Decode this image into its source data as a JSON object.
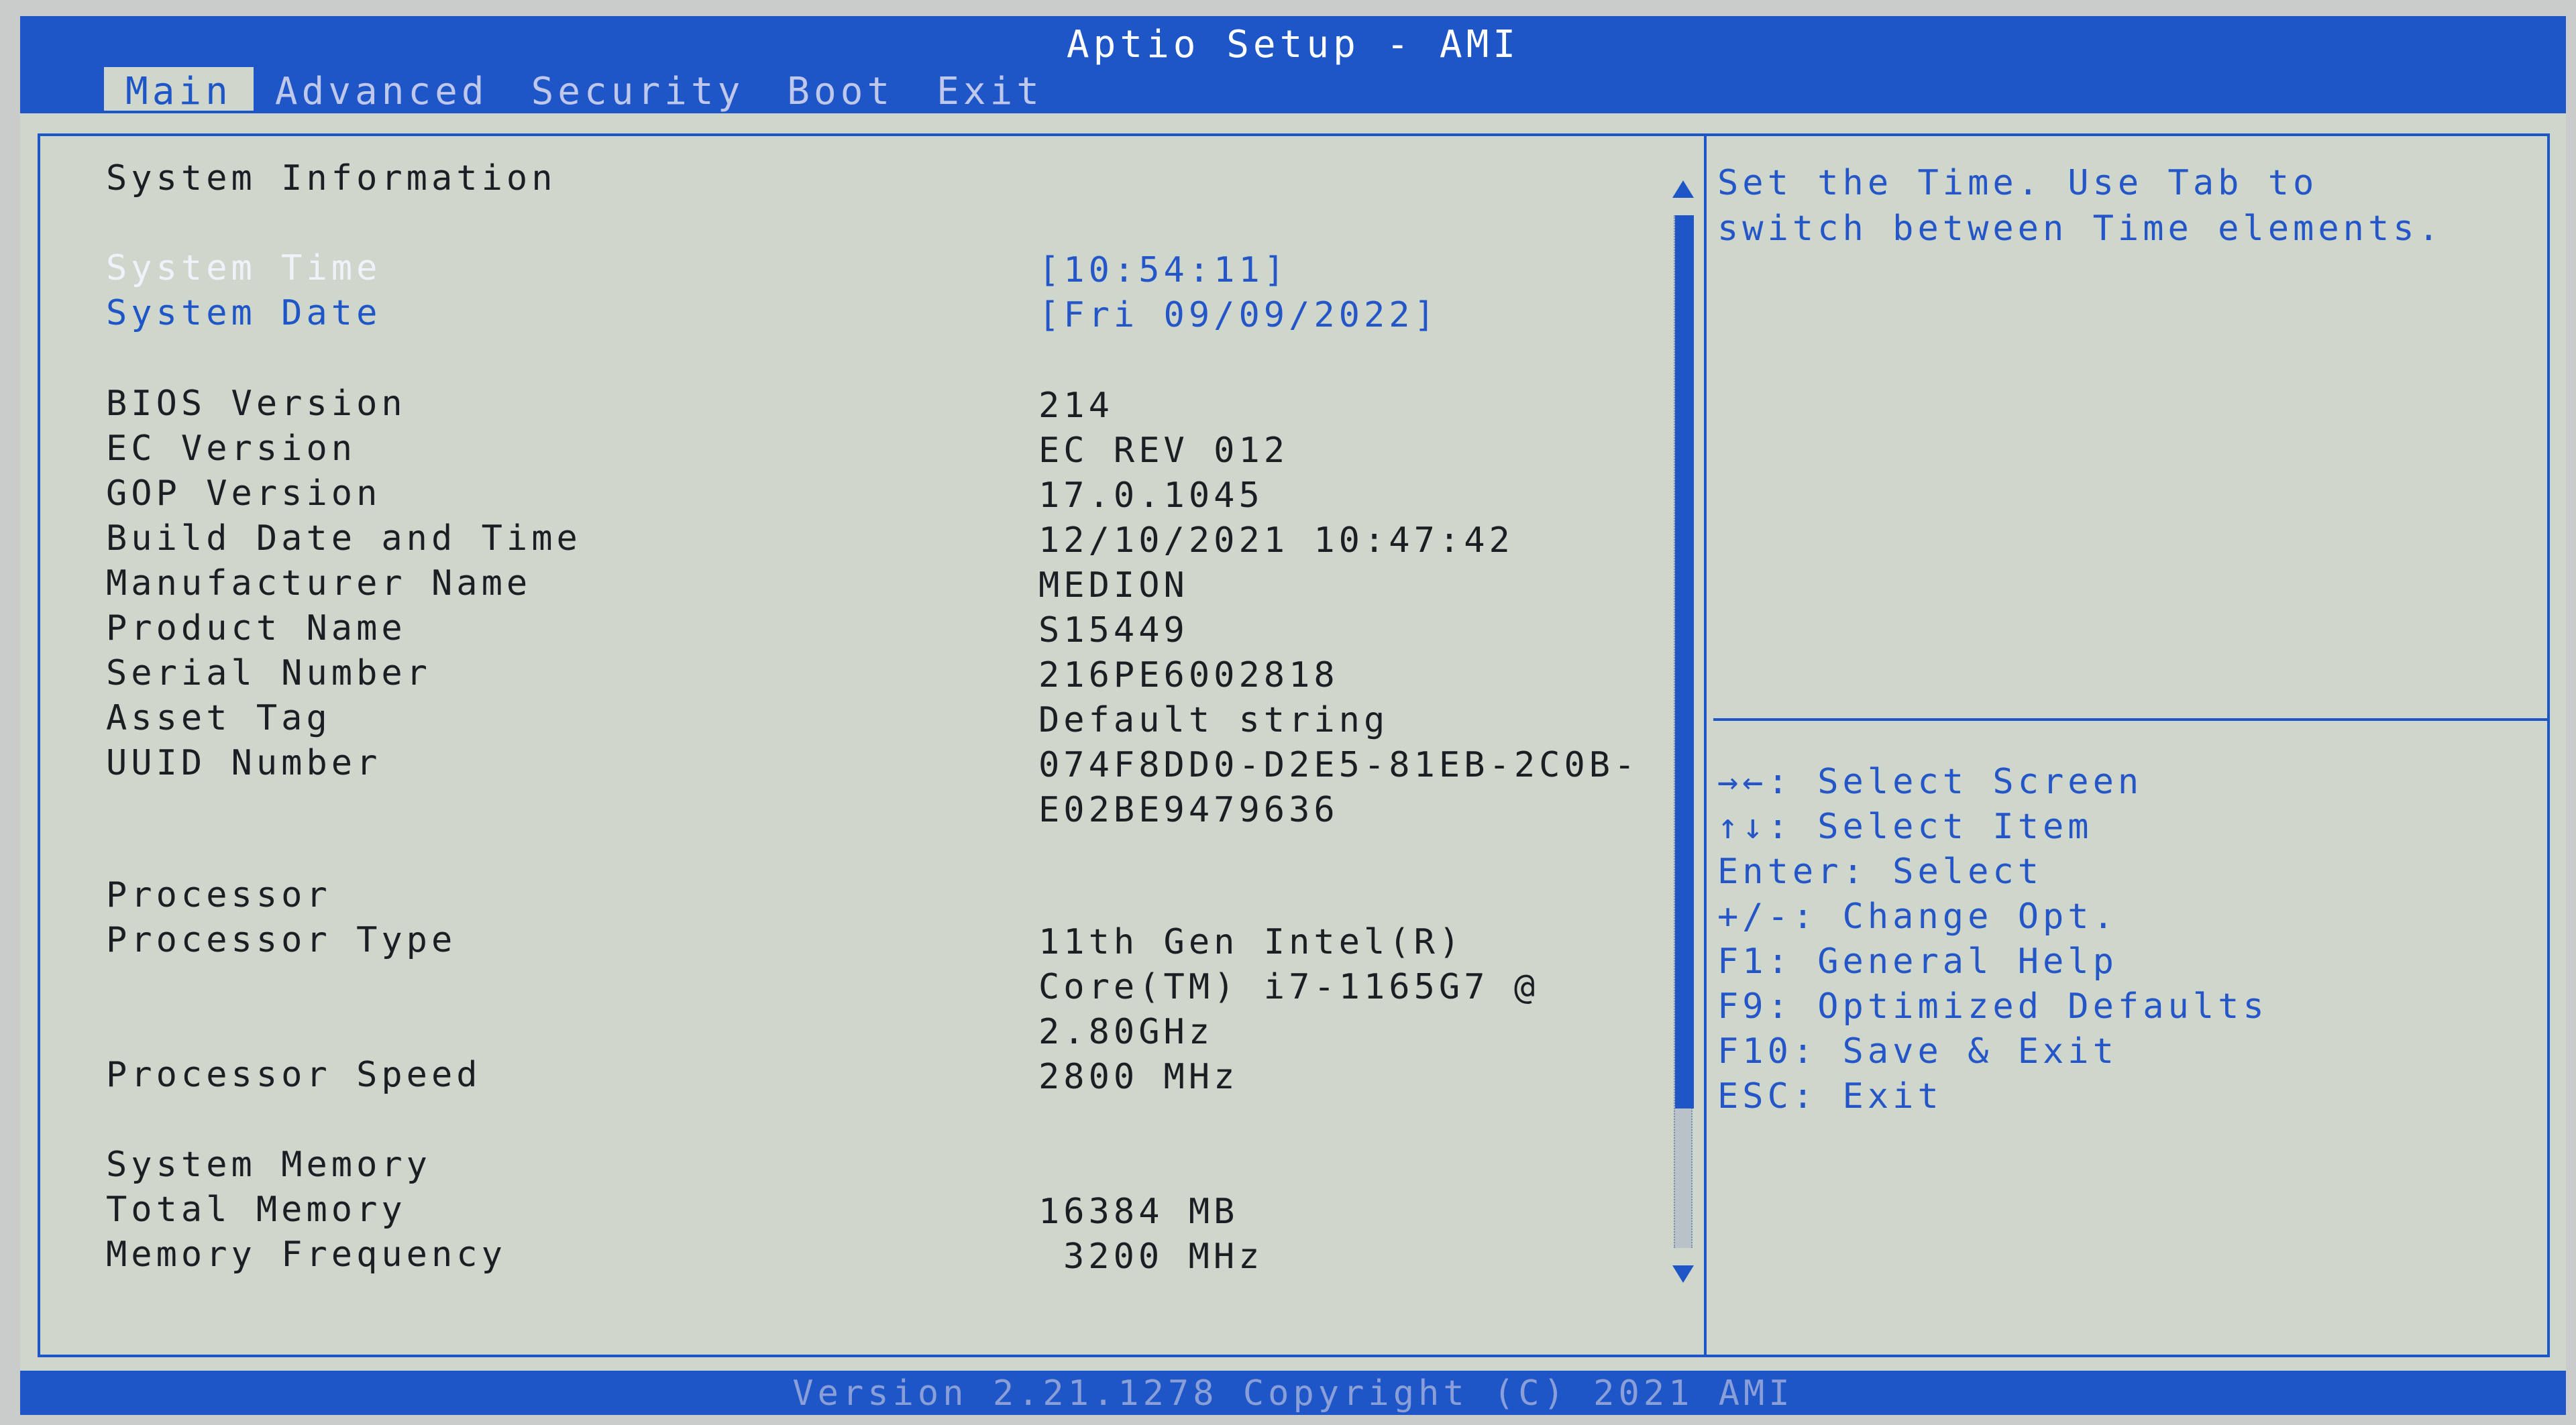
{
  "app_title": "Aptio Setup - AMI",
  "tabs": [
    {
      "label": "Main"
    },
    {
      "label": "Advanced"
    },
    {
      "label": "Security"
    },
    {
      "label": "Boot"
    },
    {
      "label": "Exit"
    }
  ],
  "active_tab": "Main",
  "main": {
    "section_system_information": "System Information",
    "system_time": {
      "label": "System Time",
      "value": "[10:54:11]"
    },
    "system_date": {
      "label": "System Date",
      "value": "[Fri 09/09/2022]"
    },
    "bios_version": {
      "label": "BIOS Version",
      "value": "214"
    },
    "ec_version": {
      "label": "EC Version",
      "value": "EC REV 012"
    },
    "gop_version": {
      "label": "GOP Version",
      "value": "17.0.1045"
    },
    "build_date": {
      "label": "Build Date and Time",
      "value": "12/10/2021 10:47:42"
    },
    "manufacturer": {
      "label": "Manufacturer Name",
      "value": "MEDION"
    },
    "product": {
      "label": "Product Name",
      "value": "S15449"
    },
    "serial": {
      "label": "Serial Number",
      "value": "216PE6002818"
    },
    "asset_tag": {
      "label": "Asset Tag",
      "value": "Default string"
    },
    "uuid": {
      "label": "UUID Number",
      "value_line1": "074F8DD0-D2E5-81EB-2C0B-",
      "value_line2": "E02BE9479636"
    },
    "section_processor": "Processor",
    "processor_type": {
      "label": "Processor Type",
      "value_line1": "11th Gen Intel(R)",
      "value_line2": "Core(TM) i7-1165G7 @",
      "value_line3": "2.80GHz"
    },
    "processor_speed": {
      "label": "Processor Speed",
      "value": "2800 MHz"
    },
    "section_memory": "System Memory",
    "total_memory": {
      "label": "Total Memory",
      "value": "16384 MB"
    },
    "memory_frequency": {
      "label": "Memory Frequency",
      "value": "3200 MHz"
    }
  },
  "help": {
    "description_line1": "Set the Time. Use Tab to",
    "description_line2": "switch between Time elements.",
    "keys": [
      {
        "key": "→←:",
        "desc": "Select Screen"
      },
      {
        "key": "↑↓:",
        "desc": "Select Item"
      },
      {
        "key": "Enter:",
        "desc": "Select"
      },
      {
        "key": "+/-:",
        "desc": "Change Opt."
      },
      {
        "key": "F1:",
        "desc": "General Help"
      },
      {
        "key": "F9:",
        "desc": "Optimized Defaults"
      },
      {
        "key": "F10:",
        "desc": "Save & Exit"
      },
      {
        "key": "ESC:",
        "desc": "Exit"
      }
    ]
  },
  "footer": "Version 2.21.1278 Copyright (C) 2021 AMI",
  "colors": {
    "accent": "#1e56c8",
    "background": "#cfd6cc",
    "text": "#1b1f24"
  }
}
